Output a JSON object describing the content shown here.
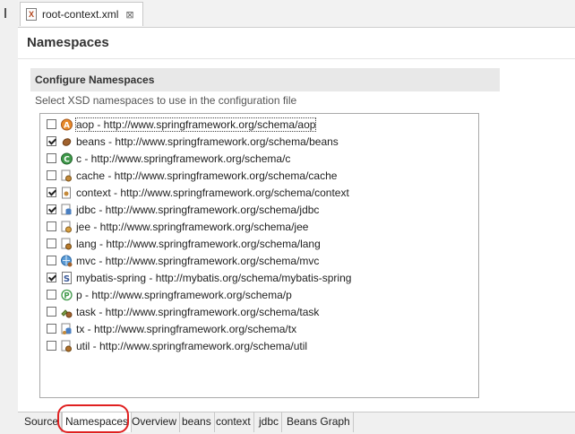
{
  "editor_tab": {
    "title": "root-context.xml",
    "close_glyph": "⊠"
  },
  "page": {
    "title": "Namespaces",
    "group_title": "Configure Namespaces",
    "description": "Select XSD namespaces to use in the configuration file"
  },
  "namespaces": [
    {
      "label": "aop - http://www.springframework.org/schema/aop",
      "checked": false,
      "icon": "aop-icon"
    },
    {
      "label": "beans - http://www.springframework.org/schema/beans",
      "checked": true,
      "icon": "bean-icon"
    },
    {
      "label": "c - http://www.springframework.org/schema/c",
      "checked": false,
      "icon": "c-icon"
    },
    {
      "label": "cache - http://www.springframework.org/schema/cache",
      "checked": false,
      "icon": "cache-icon"
    },
    {
      "label": "context - http://www.springframework.org/schema/context",
      "checked": true,
      "icon": "context-icon"
    },
    {
      "label": "jdbc - http://www.springframework.org/schema/jdbc",
      "checked": true,
      "icon": "jdbc-icon"
    },
    {
      "label": "jee - http://www.springframework.org/schema/jee",
      "checked": false,
      "icon": "jee-icon"
    },
    {
      "label": "lang - http://www.springframework.org/schema/lang",
      "checked": false,
      "icon": "lang-icon"
    },
    {
      "label": "mvc - http://www.springframework.org/schema/mvc",
      "checked": false,
      "icon": "mvc-icon"
    },
    {
      "label": "mybatis-spring - http://mybatis.org/schema/mybatis-spring",
      "checked": true,
      "icon": "mybatis-icon"
    },
    {
      "label": "p - http://www.springframework.org/schema/p",
      "checked": false,
      "icon": "p-icon"
    },
    {
      "label": "task - http://www.springframework.org/schema/task",
      "checked": false,
      "icon": "task-icon"
    },
    {
      "label": "tx - http://www.springframework.org/schema/tx",
      "checked": false,
      "icon": "tx-icon"
    },
    {
      "label": "util - http://www.springframework.org/schema/util",
      "checked": false,
      "icon": "util-icon"
    }
  ],
  "bottom_tabs": [
    {
      "label": "Source",
      "active": false
    },
    {
      "label": "Namespaces",
      "active": true
    },
    {
      "label": "Overview",
      "active": false
    },
    {
      "label": "beans",
      "active": false
    },
    {
      "label": "context",
      "active": false
    },
    {
      "label": "jdbc",
      "active": false
    },
    {
      "label": "Beans Graph",
      "active": false
    }
  ],
  "colors": {
    "annotation_oval": "#e02020",
    "group_header_bg": "#e8e8e8"
  }
}
